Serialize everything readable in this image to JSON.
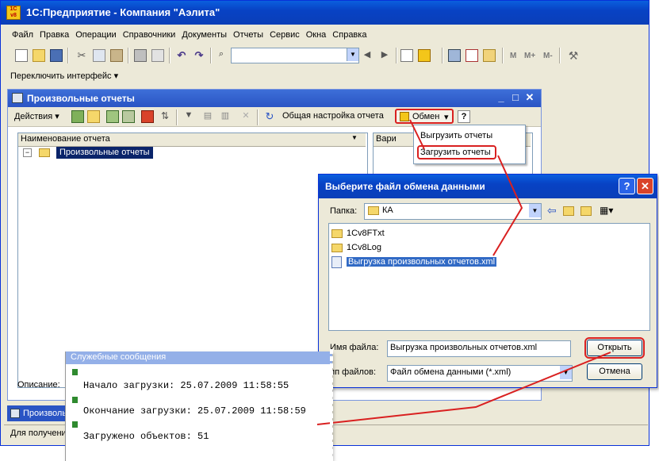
{
  "app": {
    "title": "1С:Предприятие - Компания \"Аэлита\""
  },
  "menu": [
    "Файл",
    "Правка",
    "Операции",
    "Справочники",
    "Документы",
    "Отчеты",
    "Сервис",
    "Окна",
    "Справка"
  ],
  "toolbar2": {
    "switch_label": "Переключить интерфейс"
  },
  "toolbar1": {
    "mem_labels": [
      "M",
      "M+",
      "M-"
    ]
  },
  "child": {
    "title": "Произвольные отчеты",
    "actions_label": "Действия",
    "general_settings_label": "Общая настройка отчета",
    "exchange_label": "Обмен",
    "help_label": "?",
    "column_header": "Наименование отчета",
    "variants_header": "Вари",
    "tree_root": "Произвольные отчеты",
    "description_label": "Описание:"
  },
  "exchange_menu": {
    "export": "Выгрузить отчеты",
    "import": "Загрузить отчеты"
  },
  "dialog": {
    "title": "Выберите файл обмена данными",
    "folder_label": "Папка:",
    "folder_value": "КА",
    "files": [
      {
        "name": "1Cv8FTxt",
        "kind": "folder"
      },
      {
        "name": "1Cv8Log",
        "kind": "folder"
      },
      {
        "name": "Выгрузка произвольных отчетов.xml",
        "kind": "xml"
      }
    ],
    "filename_label": "Имя файла:",
    "filename_value": "Выгрузка произвольных отчетов.xml",
    "filetype_label": "ип файлов:",
    "filetype_value": "Файл обмена данными (*.xml)",
    "open_label": "Открыть",
    "cancel_label": "Отмена"
  },
  "taskbar": {
    "item": "Произвольн"
  },
  "statusbar": {
    "text": "Для получени"
  },
  "messages": {
    "title": "Служебные сообщения",
    "lines": [
      "Начало загрузки:   25.07.2009 11:58:55",
      "Окончание загрузки: 25.07.2009 11:58:59",
      "Загружено объектов: 51"
    ]
  },
  "colors": {
    "highlight": "#d92020",
    "selection": "#0a246a",
    "xp_title": "#0842c4"
  }
}
